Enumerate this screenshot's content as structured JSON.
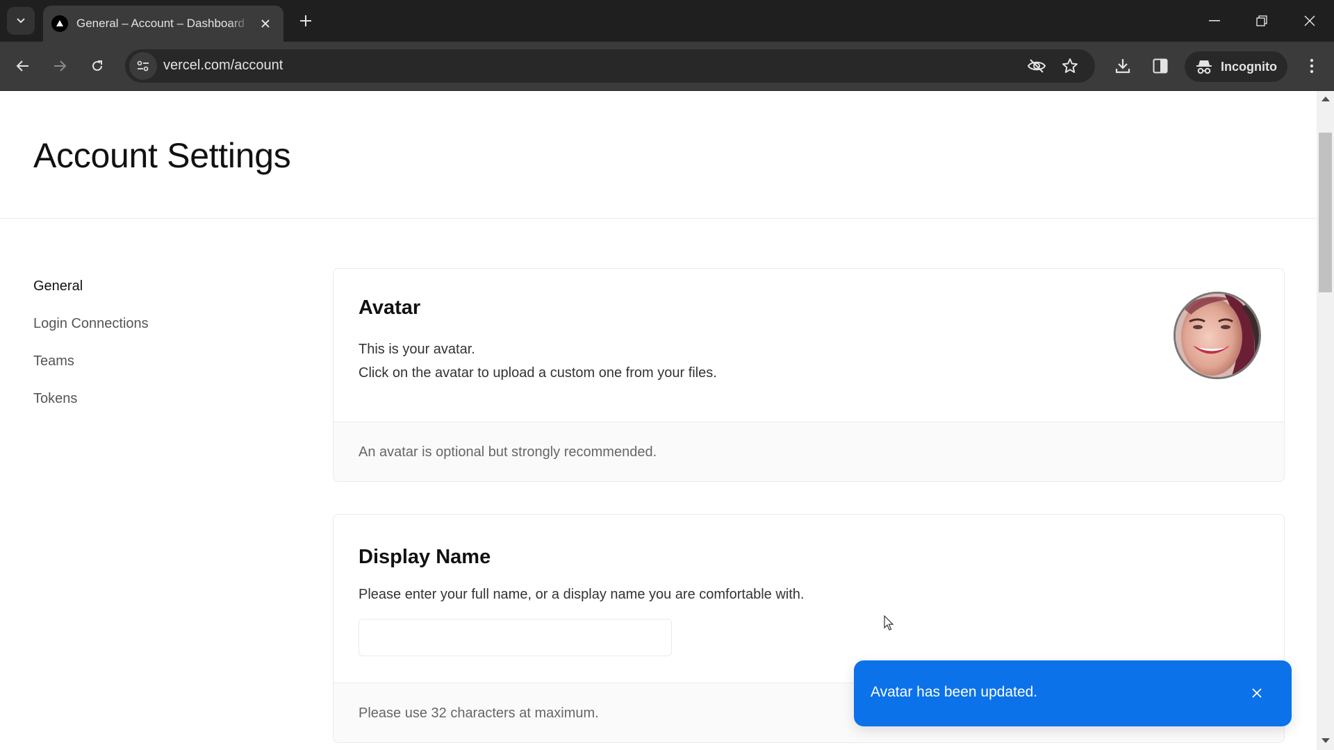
{
  "browser": {
    "tab_title": "General – Account – Dashboard",
    "url": "vercel.com/account",
    "incognito_label": "Incognito",
    "icons": {
      "tab_search": "chevron-down-icon",
      "favicon": "vercel-triangle-icon",
      "tab_close": "close-icon",
      "new_tab": "plus-icon",
      "minimize": "minimize-icon",
      "restore": "restore-icon",
      "close_window": "close-icon",
      "back": "arrow-left-icon",
      "forward": "arrow-right-icon",
      "reload": "reload-icon",
      "site_info": "tune-icon",
      "tracking": "eye-off-icon",
      "bookmark": "star-icon",
      "downloads": "download-icon",
      "side_panel": "side-panel-icon",
      "incognito": "incognito-icon",
      "menu": "kebab-menu-icon"
    }
  },
  "page": {
    "title": "Account Settings",
    "sidebar": {
      "items": [
        {
          "label": "General",
          "active": true
        },
        {
          "label": "Login Connections",
          "active": false
        },
        {
          "label": "Teams",
          "active": false
        },
        {
          "label": "Tokens",
          "active": false
        }
      ]
    },
    "avatar_card": {
      "title": "Avatar",
      "line1": "This is your avatar.",
      "line2": "Click on the avatar to upload a custom one from your files.",
      "footer": "An avatar is optional but strongly recommended."
    },
    "display_name_card": {
      "title": "Display Name",
      "description": "Please enter your full name, or a display name you are comfortable with.",
      "input_value": "",
      "footer": "Please use 32 characters at maximum."
    }
  },
  "toast": {
    "message": "Avatar has been updated.",
    "color": "#0b72ea"
  }
}
